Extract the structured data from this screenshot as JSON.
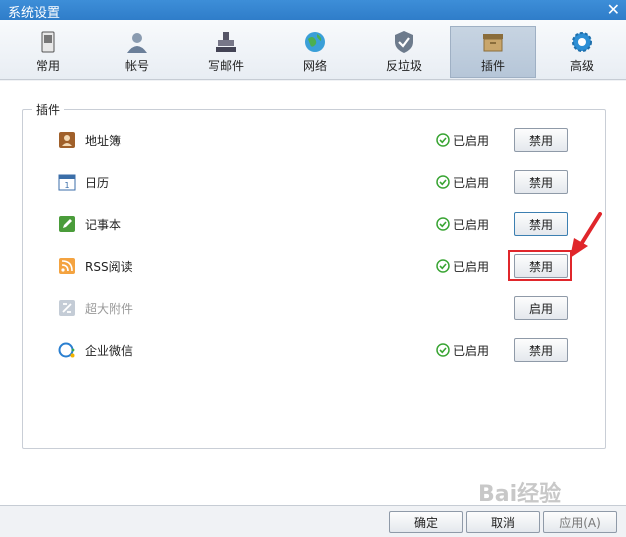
{
  "window": {
    "title": "系统设置",
    "close_glyph": "✕"
  },
  "tabs": [
    {
      "label": "常用",
      "icon": "phone-icon"
    },
    {
      "label": "帐号",
      "icon": "user-icon"
    },
    {
      "label": "写邮件",
      "icon": "stamp-icon"
    },
    {
      "label": "网络",
      "icon": "globe-icon"
    },
    {
      "label": "反垃圾",
      "icon": "shield-icon"
    },
    {
      "label": "插件",
      "icon": "box-icon",
      "active": true
    },
    {
      "label": "高级",
      "icon": "gear-icon"
    }
  ],
  "group": {
    "title": "插件"
  },
  "plugins": [
    {
      "name": "地址簿",
      "icon": "address-book-icon",
      "status": "已启用",
      "button": "禁用",
      "enabled": true
    },
    {
      "name": "日历",
      "icon": "calendar-icon",
      "status": "已启用",
      "button": "禁用",
      "enabled": true
    },
    {
      "name": "记事本",
      "icon": "notepad-icon",
      "status": "已启用",
      "button": "禁用",
      "enabled": true
    },
    {
      "name": "RSS阅读",
      "icon": "rss-icon",
      "status": "已启用",
      "button": "禁用",
      "enabled": true
    },
    {
      "name": "超大附件",
      "icon": "attachment-icon",
      "status": "",
      "button": "启用",
      "enabled": false
    },
    {
      "name": "企业微信",
      "icon": "wework-icon",
      "status": "已启用",
      "button": "禁用",
      "enabled": true
    }
  ],
  "footer": {
    "ok_label": "确定",
    "cancel_label": "取消",
    "apply_label": "应用(A)"
  },
  "watermark": "Bai经验",
  "colors": {
    "titlebar": "#2f7dc9",
    "highlight": "#e0262b",
    "status_check": "#3aa534"
  }
}
